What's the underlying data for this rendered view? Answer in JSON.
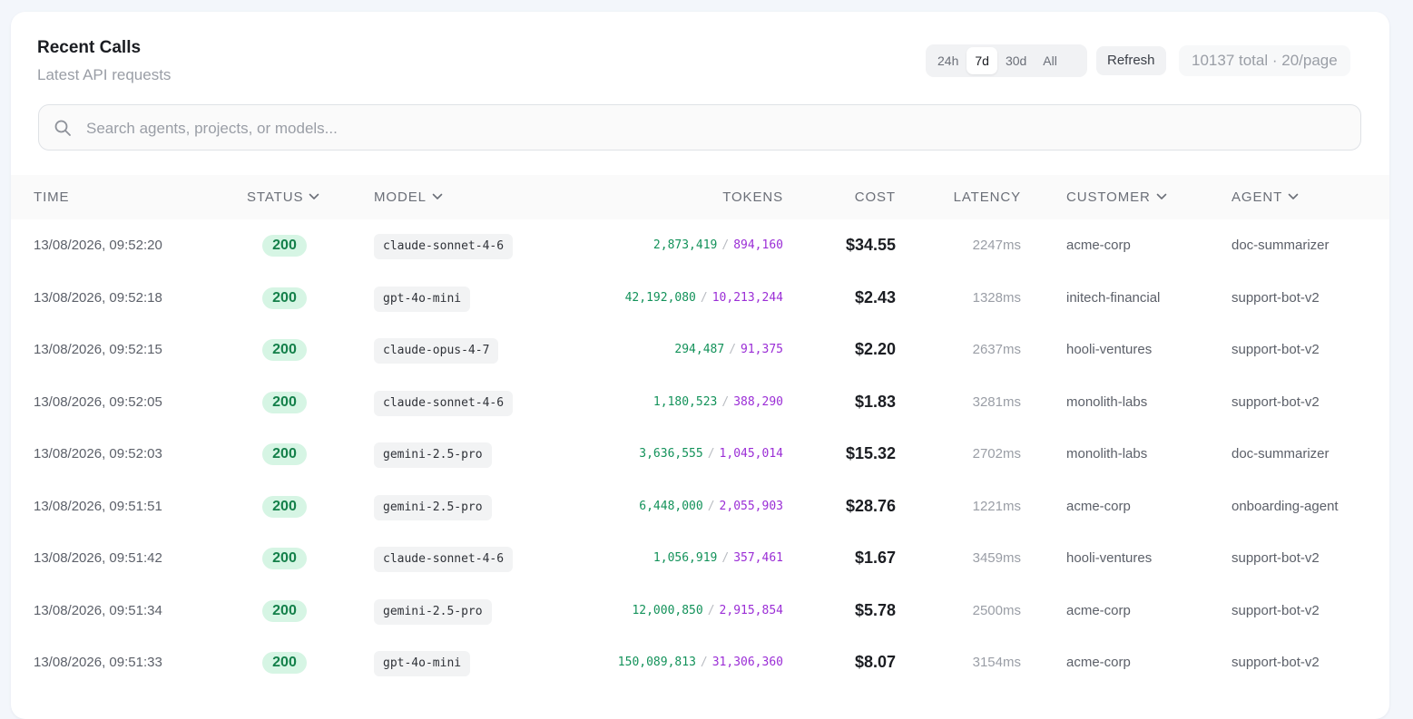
{
  "header": {
    "title": "Recent Calls",
    "subtitle": "Latest API requests"
  },
  "time_range": {
    "options": [
      "24h",
      "7d",
      "30d",
      "All"
    ],
    "selected": "7d"
  },
  "refresh_label": "Refresh",
  "pagination_summary": "10137 total · 20/page",
  "search": {
    "placeholder": "Search agents, projects, or models...",
    "value": ""
  },
  "colors": {
    "status_ok_bg": "#d6f5e4",
    "status_ok_text": "#14804a",
    "tokens_in": "#13925a",
    "tokens_out": "#9b2ed6"
  },
  "table": {
    "columns": {
      "time": "TIME",
      "status": "STATUS",
      "model": "MODEL",
      "tokens": "TOKENS",
      "cost": "COST",
      "latency": "LATENCY",
      "customer": "CUSTOMER",
      "agent": "AGENT"
    },
    "rows": [
      {
        "time": "13/08/2026, 09:52:20",
        "status": "200",
        "model": "claude-sonnet-4-6",
        "tokens_in": "2,873,419",
        "tokens_out": "894,160",
        "cost": "$34.55",
        "latency": "2247ms",
        "customer": "acme-corp",
        "agent": "doc-summarizer"
      },
      {
        "time": "13/08/2026, 09:52:18",
        "status": "200",
        "model": "gpt-4o-mini",
        "tokens_in": "42,192,080",
        "tokens_out": "10,213,244",
        "cost": "$2.43",
        "latency": "1328ms",
        "customer": "initech-financial",
        "agent": "support-bot-v2"
      },
      {
        "time": "13/08/2026, 09:52:15",
        "status": "200",
        "model": "claude-opus-4-7",
        "tokens_in": "294,487",
        "tokens_out": "91,375",
        "cost": "$2.20",
        "latency": "2637ms",
        "customer": "hooli-ventures",
        "agent": "support-bot-v2"
      },
      {
        "time": "13/08/2026, 09:52:05",
        "status": "200",
        "model": "claude-sonnet-4-6",
        "tokens_in": "1,180,523",
        "tokens_out": "388,290",
        "cost": "$1.83",
        "latency": "3281ms",
        "customer": "monolith-labs",
        "agent": "support-bot-v2"
      },
      {
        "time": "13/08/2026, 09:52:03",
        "status": "200",
        "model": "gemini-2.5-pro",
        "tokens_in": "3,636,555",
        "tokens_out": "1,045,014",
        "cost": "$15.32",
        "latency": "2702ms",
        "customer": "monolith-labs",
        "agent": "doc-summarizer"
      },
      {
        "time": "13/08/2026, 09:51:51",
        "status": "200",
        "model": "gemini-2.5-pro",
        "tokens_in": "6,448,000",
        "tokens_out": "2,055,903",
        "cost": "$28.76",
        "latency": "1221ms",
        "customer": "acme-corp",
        "agent": "onboarding-agent"
      },
      {
        "time": "13/08/2026, 09:51:42",
        "status": "200",
        "model": "claude-sonnet-4-6",
        "tokens_in": "1,056,919",
        "tokens_out": "357,461",
        "cost": "$1.67",
        "latency": "3459ms",
        "customer": "hooli-ventures",
        "agent": "support-bot-v2"
      },
      {
        "time": "13/08/2026, 09:51:34",
        "status": "200",
        "model": "gemini-2.5-pro",
        "tokens_in": "12,000,850",
        "tokens_out": "2,915,854",
        "cost": "$5.78",
        "latency": "2500ms",
        "customer": "acme-corp",
        "agent": "support-bot-v2"
      },
      {
        "time": "13/08/2026, 09:51:33",
        "status": "200",
        "model": "gpt-4o-mini",
        "tokens_in": "150,089,813",
        "tokens_out": "31,306,360",
        "cost": "$8.07",
        "latency": "3154ms",
        "customer": "acme-corp",
        "agent": "support-bot-v2"
      }
    ]
  }
}
